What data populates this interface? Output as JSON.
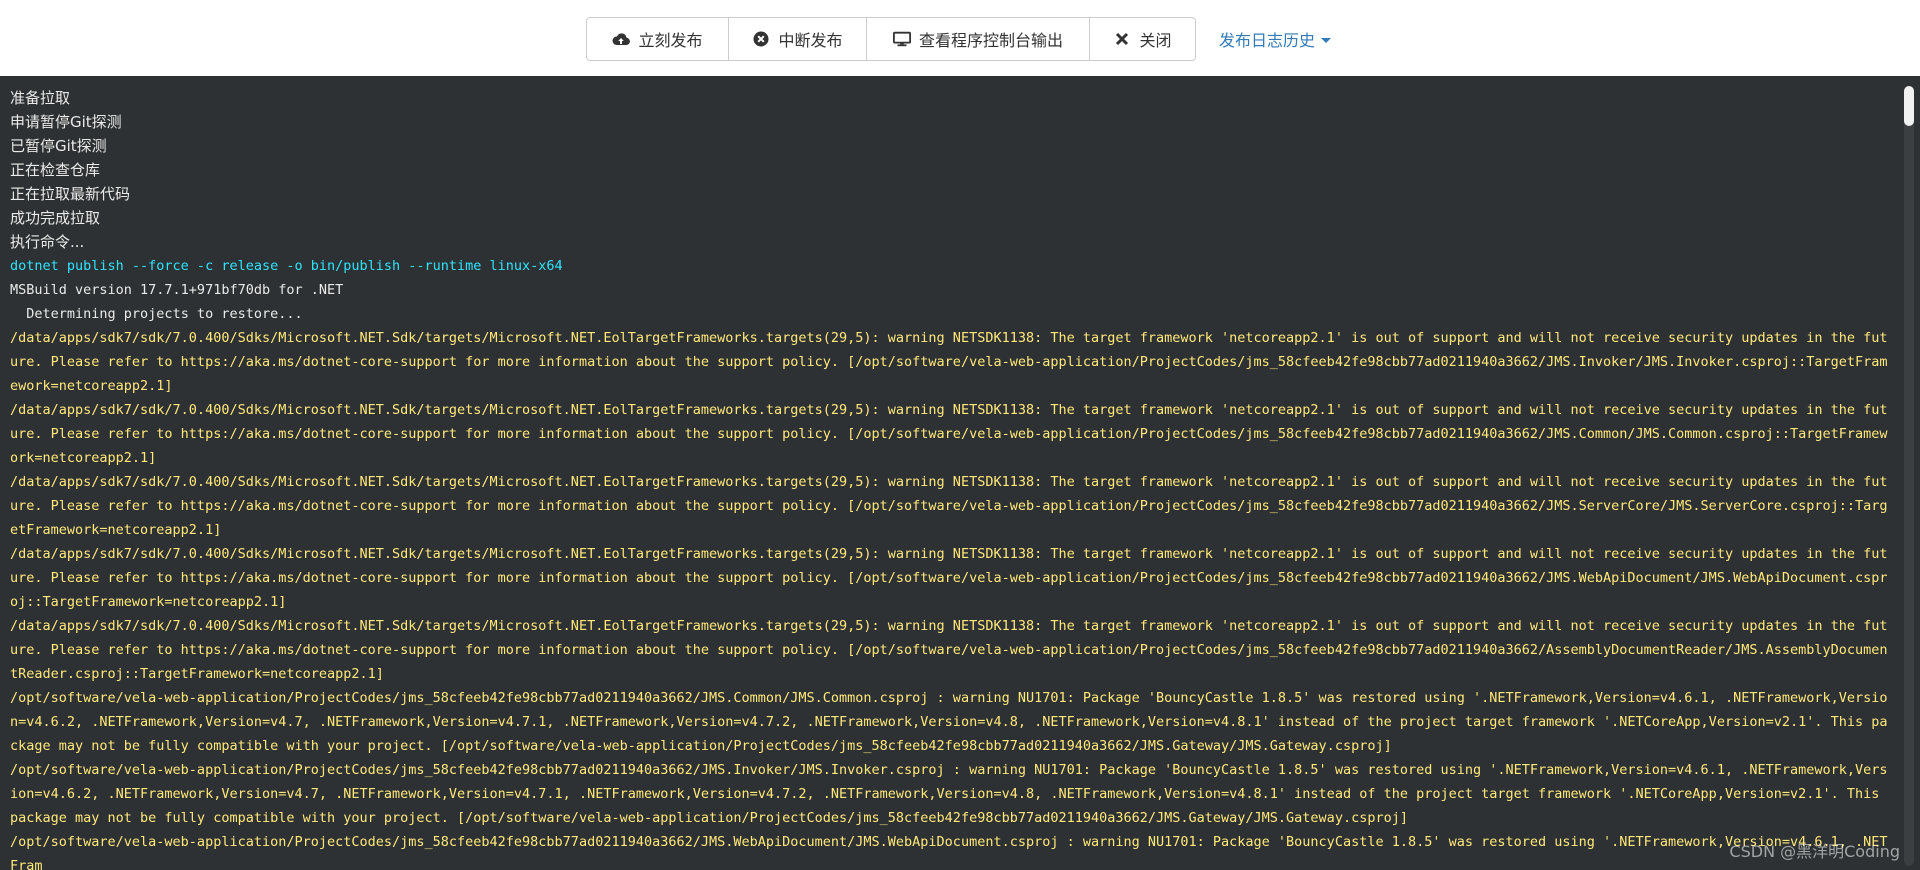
{
  "toolbar": {
    "publish_label": "立刻发布",
    "abort_label": "中断发布",
    "console_label": "查看程序控制台输出",
    "close_label": "关闭",
    "history_label": "发布日志历史"
  },
  "console": {
    "lines": [
      {
        "text": "准备拉取",
        "kind": "zh"
      },
      {
        "text": "申请暂停Git探测",
        "kind": "zh"
      },
      {
        "text": "已暂停Git探测",
        "kind": "zh"
      },
      {
        "text": "正在检查仓库",
        "kind": "zh"
      },
      {
        "text": "正在拉取最新代码",
        "kind": "zh"
      },
      {
        "text": "成功完成拉取",
        "kind": "zh"
      },
      {
        "text": "执行命令...",
        "kind": "zh"
      },
      {
        "text": "dotnet publish --force -c release -o bin/publish --runtime linux-x64",
        "kind": "cmd"
      },
      {
        "text": "MSBuild version 17.7.1+971bf70db for .NET",
        "kind": "normal"
      },
      {
        "text": "  Determining projects to restore...",
        "kind": "normal"
      },
      {
        "text": "/data/apps/sdk7/sdk/7.0.400/Sdks/Microsoft.NET.Sdk/targets/Microsoft.NET.EolTargetFrameworks.targets(29,5): warning NETSDK1138: The target framework 'netcoreapp2.1' is out of support and will not receive security updates in the future. Please refer to https://aka.ms/dotnet-core-support for more information about the support policy. [/opt/software/vela-web-application/ProjectCodes/jms_58cfeeb42fe98cbb77ad0211940a3662/JMS.Invoker/JMS.Invoker.csproj::TargetFramework=netcoreapp2.1]",
        "kind": "warn"
      },
      {
        "text": "/data/apps/sdk7/sdk/7.0.400/Sdks/Microsoft.NET.Sdk/targets/Microsoft.NET.EolTargetFrameworks.targets(29,5): warning NETSDK1138: The target framework 'netcoreapp2.1' is out of support and will not receive security updates in the future. Please refer to https://aka.ms/dotnet-core-support for more information about the support policy. [/opt/software/vela-web-application/ProjectCodes/jms_58cfeeb42fe98cbb77ad0211940a3662/JMS.Common/JMS.Common.csproj::TargetFramework=netcoreapp2.1]",
        "kind": "warn"
      },
      {
        "text": "/data/apps/sdk7/sdk/7.0.400/Sdks/Microsoft.NET.Sdk/targets/Microsoft.NET.EolTargetFrameworks.targets(29,5): warning NETSDK1138: The target framework 'netcoreapp2.1' is out of support and will not receive security updates in the future. Please refer to https://aka.ms/dotnet-core-support for more information about the support policy. [/opt/software/vela-web-application/ProjectCodes/jms_58cfeeb42fe98cbb77ad0211940a3662/JMS.ServerCore/JMS.ServerCore.csproj::TargetFramework=netcoreapp2.1]",
        "kind": "warn"
      },
      {
        "text": "/data/apps/sdk7/sdk/7.0.400/Sdks/Microsoft.NET.Sdk/targets/Microsoft.NET.EolTargetFrameworks.targets(29,5): warning NETSDK1138: The target framework 'netcoreapp2.1' is out of support and will not receive security updates in the future. Please refer to https://aka.ms/dotnet-core-support for more information about the support policy. [/opt/software/vela-web-application/ProjectCodes/jms_58cfeeb42fe98cbb77ad0211940a3662/JMS.WebApiDocument/JMS.WebApiDocument.csproj::TargetFramework=netcoreapp2.1]",
        "kind": "warn"
      },
      {
        "text": "/data/apps/sdk7/sdk/7.0.400/Sdks/Microsoft.NET.Sdk/targets/Microsoft.NET.EolTargetFrameworks.targets(29,5): warning NETSDK1138: The target framework 'netcoreapp2.1' is out of support and will not receive security updates in the future. Please refer to https://aka.ms/dotnet-core-support for more information about the support policy. [/opt/software/vela-web-application/ProjectCodes/jms_58cfeeb42fe98cbb77ad0211940a3662/AssemblyDocumentReader/JMS.AssemblyDocumentReader.csproj::TargetFramework=netcoreapp2.1]",
        "kind": "warn"
      },
      {
        "text": "/opt/software/vela-web-application/ProjectCodes/jms_58cfeeb42fe98cbb77ad0211940a3662/JMS.Common/JMS.Common.csproj : warning NU1701: Package 'BouncyCastle 1.8.5' was restored using '.NETFramework,Version=v4.6.1, .NETFramework,Version=v4.6.2, .NETFramework,Version=v4.7, .NETFramework,Version=v4.7.1, .NETFramework,Version=v4.7.2, .NETFramework,Version=v4.8, .NETFramework,Version=v4.8.1' instead of the project target framework '.NETCoreApp,Version=v2.1'. This package may not be fully compatible with your project. [/opt/software/vela-web-application/ProjectCodes/jms_58cfeeb42fe98cbb77ad0211940a3662/JMS.Gateway/JMS.Gateway.csproj]",
        "kind": "warn"
      },
      {
        "text": "/opt/software/vela-web-application/ProjectCodes/jms_58cfeeb42fe98cbb77ad0211940a3662/JMS.Invoker/JMS.Invoker.csproj : warning NU1701: Package 'BouncyCastle 1.8.5' was restored using '.NETFramework,Version=v4.6.1, .NETFramework,Version=v4.6.2, .NETFramework,Version=v4.7, .NETFramework,Version=v4.7.1, .NETFramework,Version=v4.7.2, .NETFramework,Version=v4.8, .NETFramework,Version=v4.8.1' instead of the project target framework '.NETCoreApp,Version=v2.1'. This package may not be fully compatible with your project. [/opt/software/vela-web-application/ProjectCodes/jms_58cfeeb42fe98cbb77ad0211940a3662/JMS.Gateway/JMS.Gateway.csproj]",
        "kind": "warn"
      },
      {
        "text": "/opt/software/vela-web-application/ProjectCodes/jms_58cfeeb42fe98cbb77ad0211940a3662/JMS.WebApiDocument/JMS.WebApiDocument.csproj : warning NU1701: Package 'BouncyCastle 1.8.5' was restored using '.NETFramework,Version=v4.6.1, .NETFram",
        "kind": "warn"
      }
    ]
  },
  "watermark": "CSDN @黑洋明Coding",
  "colors": {
    "console_bg": "#2d3133",
    "command": "#2fe4ff",
    "warning": "#ffe87a",
    "normal": "#eaeaea",
    "link": "#337ab7"
  },
  "icons": {
    "publish": "cloud-upload-icon",
    "abort": "times-circle-icon",
    "console": "monitor-icon",
    "close": "close-icon"
  }
}
